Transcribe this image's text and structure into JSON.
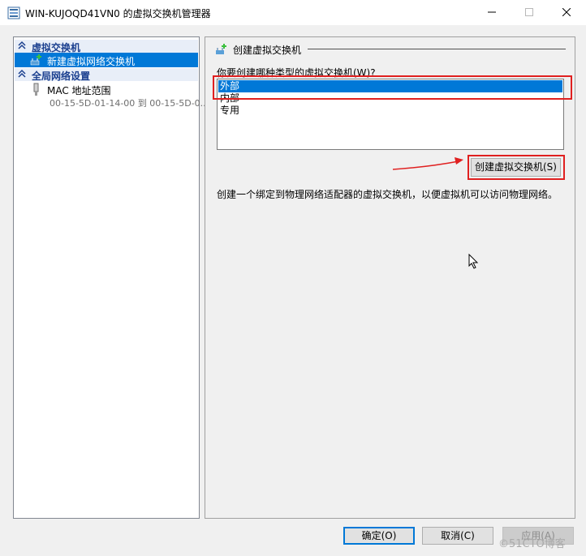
{
  "window": {
    "title": "WIN-KUJOQD41VN0 的虚拟交换机管理器",
    "minimize_glyph": "—",
    "maximize_glyph": "☐",
    "close_glyph": "✕"
  },
  "sidebar": {
    "sections": [
      {
        "label": "虚拟交换机",
        "icon": "chevron-up-icon"
      },
      {
        "label": "全局网络设置",
        "icon": "chevron-up-icon"
      }
    ],
    "items": [
      {
        "label": "新建虚拟网络交换机",
        "icon": "new-switch-icon",
        "selected": true
      },
      {
        "label": "MAC 地址范围",
        "sub": "00-15-5D-01-14-00 到 00-15-5D-0...",
        "icon": "network-adapter-icon"
      }
    ]
  },
  "panel": {
    "title": "创建虚拟交换机",
    "question": "你要创建哪种类型的虚拟交换机(W)?",
    "options": [
      "外部",
      "内部",
      "专用"
    ],
    "selected_option": "外部",
    "create_button": "创建虚拟交换机(S)",
    "description": "创建一个绑定到物理网络适配器的虚拟交换机，以便虚拟机可以访问物理网络。"
  },
  "footer": {
    "ok": "确定(O)",
    "cancel": "取消(C)",
    "apply": "应用(A)"
  },
  "watermark": "©51CTO博客",
  "colors": {
    "selection": "#0078d7",
    "section_text": "#1a3f8f",
    "highlight_box": "#e02020"
  }
}
